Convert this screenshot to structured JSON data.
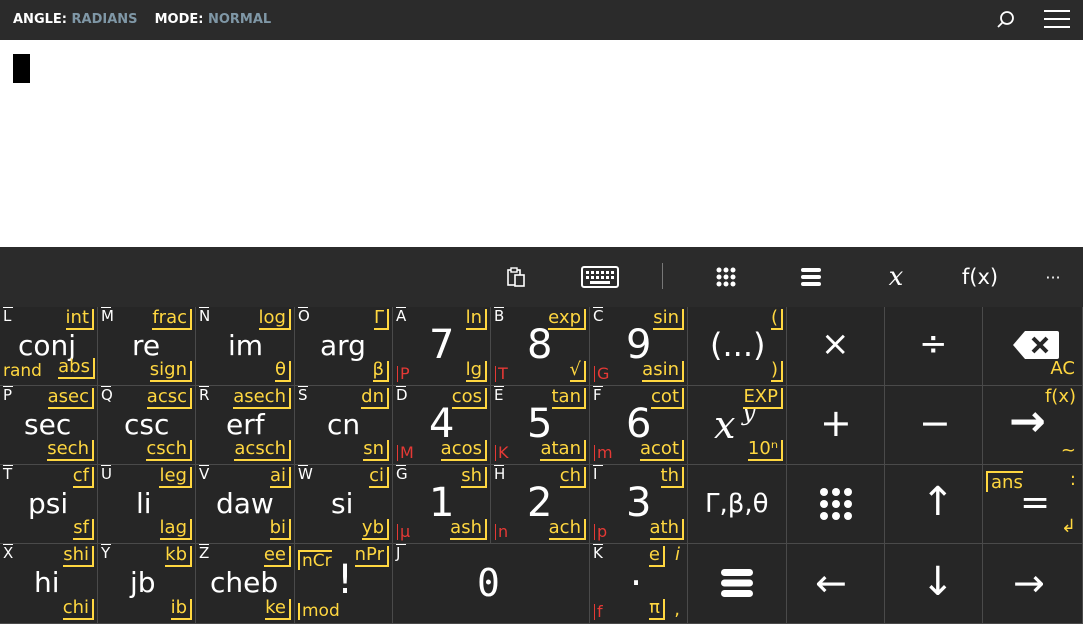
{
  "status": {
    "angle_label": "ANGLE:",
    "angle_value": "RADIANS",
    "mode_label": "MODE:",
    "mode_value": "NORMAL"
  },
  "toolbar": {
    "fx_label": "f(x)",
    "x_label": "x",
    "more_label": "···"
  },
  "keys": {
    "conj": {
      "letter": "L",
      "main": "conj",
      "tr": "int",
      "br": "abs",
      "bl": "rand"
    },
    "re": {
      "letter": "M",
      "main": "re",
      "tr": "frac",
      "br": "sign"
    },
    "im": {
      "letter": "N",
      "main": "im",
      "tr": "log",
      "br": "θ"
    },
    "arg": {
      "letter": "O",
      "main": "arg",
      "tr": "Γ",
      "br": "β"
    },
    "seven": {
      "letter": "A",
      "main": "7",
      "tr": "ln",
      "br": "lg",
      "red": "P"
    },
    "eight": {
      "letter": "B",
      "main": "8",
      "tr": "exp",
      "br": "√",
      "red": "T"
    },
    "nine": {
      "letter": "C",
      "main": "9",
      "tr": "sin",
      "br": "asin",
      "red": "G"
    },
    "paren": {
      "main": "(...)",
      "tr": "(",
      "br": ")"
    },
    "multiply": {
      "main": "×"
    },
    "divide": {
      "main": "÷"
    },
    "backspace": {
      "br": "AC"
    },
    "sec": {
      "letter": "P",
      "main": "sec",
      "tr": "asec",
      "br": "sech"
    },
    "csc": {
      "letter": "Q",
      "main": "csc",
      "tr": "acsc",
      "br": "csch"
    },
    "erf": {
      "letter": "R",
      "main": "erf",
      "tr": "asech",
      "br": "acsch"
    },
    "cn": {
      "letter": "S",
      "main": "cn",
      "tr": "dn",
      "br": "sn"
    },
    "four": {
      "letter": "D",
      "main": "4",
      "tr": "cos",
      "br": "acos",
      "red": "M"
    },
    "five": {
      "letter": "E",
      "main": "5",
      "tr": "tan",
      "br": "atan",
      "red": "K"
    },
    "six": {
      "letter": "F",
      "main": "6",
      "tr": "cot",
      "br": "acot",
      "red": "m"
    },
    "power": {
      "main": "x",
      "sup": "y",
      "tr": "EXP",
      "br": "10ⁿ"
    },
    "plus": {
      "main": "+"
    },
    "minus": {
      "main": "−"
    },
    "enter": {
      "main": "→",
      "tr": "f(x)",
      "br": "~"
    },
    "psi": {
      "letter": "T",
      "main": "psi",
      "tr": "cf",
      "br": "sf"
    },
    "li": {
      "letter": "U",
      "main": "li",
      "tr": "leg",
      "br": "lag"
    },
    "daw": {
      "letter": "V",
      "main": "daw",
      "tr": "ai",
      "br": "bi"
    },
    "si": {
      "letter": "W",
      "main": "si",
      "tr": "ci",
      "br": "yb"
    },
    "one": {
      "letter": "G",
      "main": "1",
      "tr": "sh",
      "br": "ash",
      "red": "µ"
    },
    "two": {
      "letter": "H",
      "main": "2",
      "tr": "ch",
      "br": "ach",
      "red": "n"
    },
    "three": {
      "letter": "I",
      "main": "3",
      "tr": "th",
      "br": "ath",
      "red": "p"
    },
    "gamma": {
      "main": "Γ,β,θ"
    },
    "up": {
      "main": "↑"
    },
    "equals": {
      "main": "=",
      "tl": "ans",
      "tr": ":",
      "br": "↲"
    },
    "hi": {
      "letter": "X",
      "main": "hi",
      "tr": "shi",
      "br": "chi"
    },
    "jb": {
      "letter": "Y",
      "main": "jb",
      "tr": "kb",
      "br": "ib"
    },
    "cheb": {
      "letter": "Z",
      "main": "cheb",
      "tr": "ee",
      "br": "ke"
    },
    "fact": {
      "main": "!",
      "tl": "nCr",
      "tr": "nPr",
      "bl": "mod"
    },
    "zero": {
      "letter": "J",
      "main": "0"
    },
    "dot": {
      "letter": "K",
      "main": "·",
      "tr": "e",
      "tr2": "i",
      "br": "π",
      "br2": ",",
      "red": "f"
    },
    "left": {
      "main": "←"
    },
    "down": {
      "main": "↓"
    },
    "right": {
      "main": "→"
    }
  }
}
